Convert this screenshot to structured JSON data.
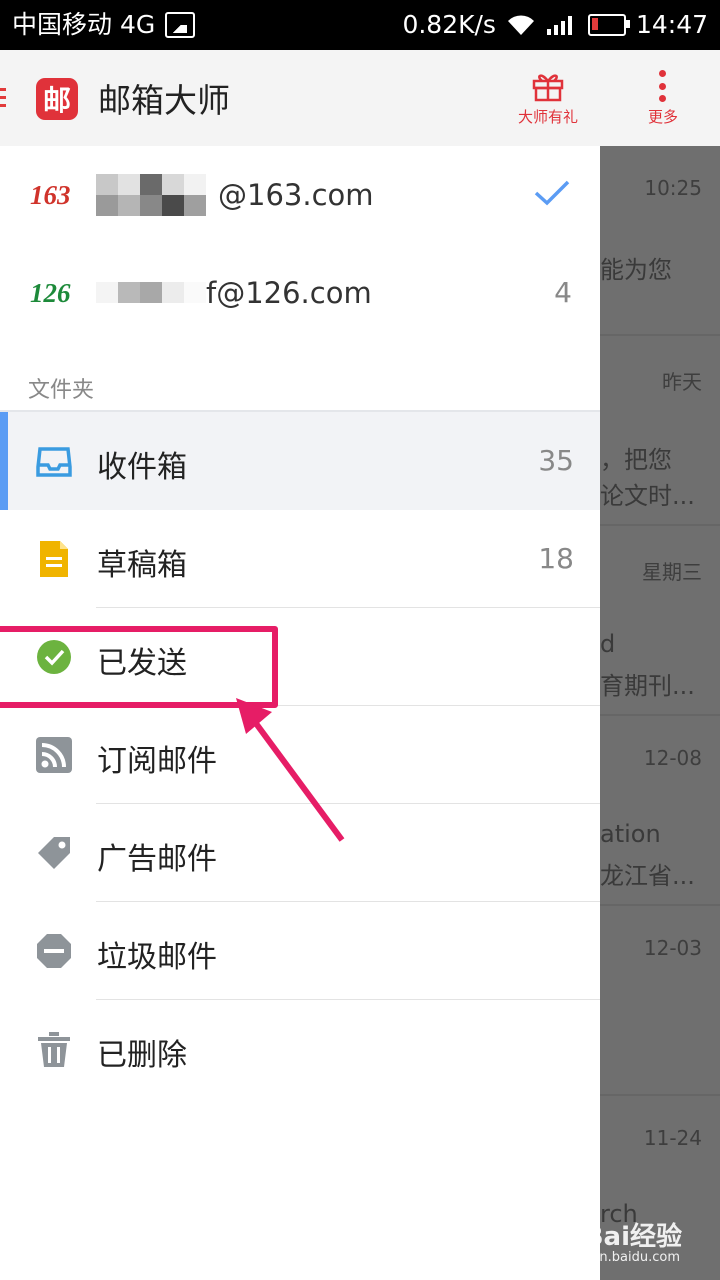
{
  "status_bar": {
    "carrier": "中国移动 4G",
    "speed": "0.82K/s",
    "time": "14:47"
  },
  "app_bar": {
    "logo_char": "邮",
    "title": "邮箱大师",
    "gift_label": "大师有礼",
    "more_label": "更多",
    "accent_color": "#e0323a"
  },
  "accounts": [
    {
      "logo": "163",
      "email": "@163.com",
      "selected": true
    },
    {
      "logo": "126",
      "email": "f@126.com",
      "count": "4"
    }
  ],
  "folders_label": "文件夹",
  "folders": [
    {
      "label": "收件箱",
      "count": "35",
      "icon": "inbox-icon",
      "active": true
    },
    {
      "label": "草稿箱",
      "count": "18",
      "icon": "draft-icon"
    },
    {
      "label": "已发送",
      "icon": "sent-check-icon"
    },
    {
      "label": "订阅邮件",
      "icon": "rss-icon"
    },
    {
      "label": "广告邮件",
      "icon": "tag-icon"
    },
    {
      "label": "垃圾邮件",
      "icon": "spam-icon"
    },
    {
      "label": "已删除",
      "icon": "trash-icon"
    }
  ],
  "background_list": [
    {
      "date": "10:25",
      "line1": "能为您",
      "line2": ""
    },
    {
      "date": "昨天",
      "line1": "，把您",
      "line2": "论文时..."
    },
    {
      "date": "星期三",
      "line1": "d",
      "line2": "育期刊..."
    },
    {
      "date": "12-08",
      "line1": "ation",
      "line2": "龙江省..."
    },
    {
      "date": "12-03",
      "line1": "",
      "line2": ""
    },
    {
      "date": "11-24",
      "line1": "rch",
      "line2": ""
    }
  ],
  "watermark": {
    "brand": "Bai经验",
    "url": "jingyan.baidu.com"
  }
}
